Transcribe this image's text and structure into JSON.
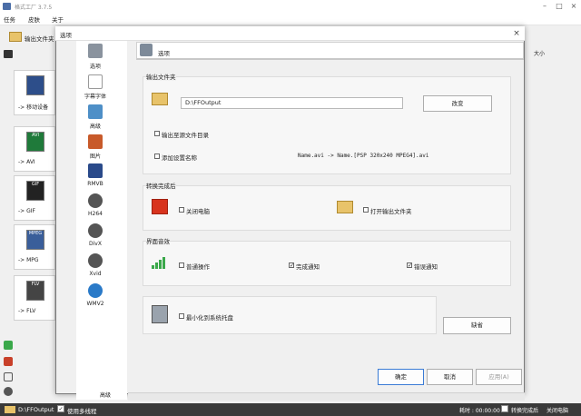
{
  "app": {
    "title": "格式工厂 3.7.5"
  },
  "menu": [
    "任务",
    "皮肤",
    "关于"
  ],
  "toolbar": {
    "output_folder": "输出文件夹"
  },
  "list": {
    "column_size": "大小"
  },
  "categories": [
    "-> 移动设备",
    "-> AVI",
    "-> GIF",
    "-> MPG",
    "-> FLV"
  ],
  "category_icons": [
    "",
    "AVI",
    "GIF",
    "MPEG",
    "FLV"
  ],
  "statusbar": {
    "path": "D:\\FFOutput",
    "multithread": "使用多线程",
    "elapsed": "耗时 : 00:00:00",
    "notify": "转换完成后",
    "shutdown": "关闭电脑"
  },
  "dialog": {
    "title": "选项",
    "page_title": "选项",
    "nav": [
      "选项",
      "字幕字体",
      "高级",
      "图片",
      "RMVB",
      "H264",
      "DivX",
      "Xvid",
      "WMV2"
    ],
    "nav_bottom": "高级",
    "output_group": {
      "title": "输出文件夹",
      "path": "D:\\FFOutput",
      "change": "改变",
      "output_to_source": "输出至源文件目录",
      "add_setting_name": "添加设置名称",
      "example": "Name.avi  -> Name.[PSP 320x240 MPEG4].avi"
    },
    "after_group": {
      "title": "转换完成后",
      "shutdown": "关闭电脑",
      "open_output": "打开输出文件夹"
    },
    "sound_group": {
      "title": "界面音效",
      "normal": "普通操作",
      "done": "完成通知",
      "error": "错误通知"
    },
    "tray": {
      "minimize": "最小化到系统托盘"
    },
    "buttons": {
      "default": "缺省",
      "ok": "确定",
      "cancel": "取消",
      "apply": "应用(A)"
    }
  }
}
